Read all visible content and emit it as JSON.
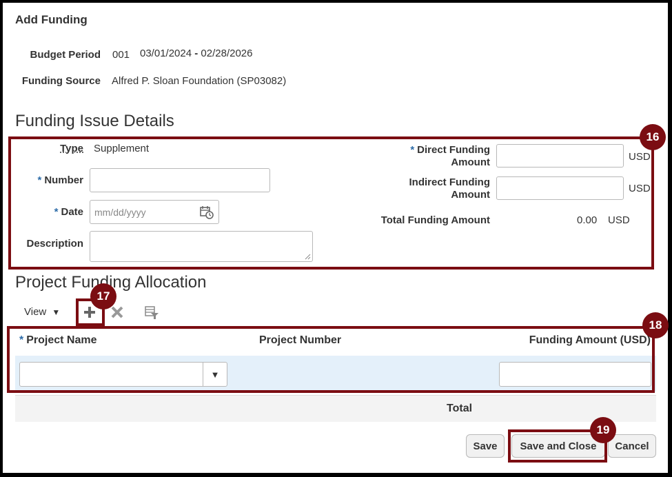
{
  "page": {
    "title": "Add Funding"
  },
  "header": {
    "budget_period_label": "Budget Period",
    "budget_period_number": "001",
    "budget_period_start": "03/01/2024",
    "budget_period_sep": " - ",
    "budget_period_end": "02/28/2026",
    "funding_source_label": "Funding Source",
    "funding_source_value": "Alfred P. Sloan Foundation (SP03082)"
  },
  "issue_details": {
    "heading": "Funding Issue Details",
    "type_label": "Type",
    "type_value": "Supplement",
    "number_label": "Number",
    "date_label": "Date",
    "date_placeholder": "mm/dd/yyyy",
    "description_label": "Description",
    "direct_label_1": "Direct Funding",
    "direct_label_2": "Amount",
    "indirect_label_1": "Indirect Funding",
    "indirect_label_2": "Amount",
    "currency": "USD",
    "total_label": "Total Funding Amount",
    "total_value": "0.00",
    "required_mark": "*"
  },
  "allocation": {
    "heading": "Project Funding Allocation",
    "view_label": "View",
    "columns": {
      "project_name": "Project Name",
      "project_number": "Project Number",
      "funding_amount": "Funding Amount (USD)"
    },
    "total_label": "Total"
  },
  "callouts": [
    "16",
    "17",
    "18",
    "19"
  ],
  "buttons": {
    "save": "Save",
    "save_close": "Save and Close",
    "cancel": "Cancel"
  },
  "colors": {
    "callout": "#7b0d12",
    "accent": "#2d6ca8",
    "row_highlight": "#e4f0fa"
  }
}
